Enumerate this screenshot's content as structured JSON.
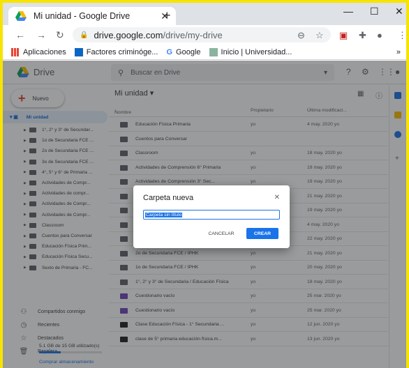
{
  "browser": {
    "tab_title": "Mi unidad - Google Drive",
    "tab_close": "✕",
    "new_tab": "+",
    "min": "—",
    "max": "☐",
    "close": "✕",
    "url_domain": "drive.google.com",
    "url_path": "/drive/my-drive",
    "bookmarks": [
      "Aplicaciones",
      "Factores criminóge...",
      "Google",
      "Inicio | Universidad..."
    ],
    "more": "»"
  },
  "drive": {
    "logo_text": "Drive",
    "search_placeholder": "Buscar en Drive",
    "new_button": "Nuevo",
    "my_drive": "Mi unidad",
    "tree": [
      "1°, 2° y 3° de Secundar...",
      "1o de Secundaria FCE ...",
      "2o de Secundaria FCE ...",
      "3o de Secundaria FCE ...",
      "4°, 5° y 6° de Primaria ...",
      "Actividades de Compr...",
      "Actividades de compr...",
      "Actividades de Compr...",
      "Actividades de Compr...",
      "Classroom",
      "Cuentos para Conversar",
      "Educación Física Prim...",
      "Educación Física Secu...",
      "Sexto de Primaria - FC..."
    ],
    "nav": [
      "Compartidos conmigo",
      "Recientes",
      "Destacados",
      "Papelera"
    ],
    "storage_text": "5.1 GB de 15 GB utilizado(s)",
    "storage_fraction": 0.34,
    "buy_storage": "Comprar almacenamiento",
    "breadcrumb": "Mi unidad",
    "columns": [
      "Nombre",
      "Propietario",
      "Última modificaci..."
    ],
    "rows": [
      {
        "name": "Educación Física Primaria",
        "owner": "yo",
        "modified": "4 may. 2020 yo",
        "type": "folder"
      },
      {
        "name": "Cuentos para Conversar",
        "owner": "",
        "modified": "",
        "type": "shared"
      },
      {
        "name": "Classroom",
        "owner": "yo",
        "modified": "18 may. 2020 yo",
        "type": "folder"
      },
      {
        "name": "Actividades de Comprensión 6° Primaria",
        "owner": "yo",
        "modified": "19 may. 2020 yo",
        "type": "shared"
      },
      {
        "name": "Actividades de Comprensión 3° Sec...",
        "owner": "yo",
        "modified": "19 may. 2020 yo",
        "type": "shared"
      },
      {
        "name": "",
        "owner": "",
        "modified": "21 may. 2020 yo",
        "type": "shared"
      },
      {
        "name": "",
        "owner": "",
        "modified": "19 may. 2020 yo",
        "type": "shared"
      },
      {
        "name": "",
        "owner": "",
        "modified": "4 may. 2020 yo",
        "type": "shared"
      },
      {
        "name": "3o de Secundaria FCE / IPHK",
        "owner": "yo",
        "modified": "22 may. 2020 yo",
        "type": "shared"
      },
      {
        "name": "2o de Secundaria FCE / IPHK",
        "owner": "yo",
        "modified": "21 may. 2020 yo",
        "type": "shared"
      },
      {
        "name": "1o de Secundaria FCE / IPHK",
        "owner": "yo",
        "modified": "20 may. 2020 yo",
        "type": "shared"
      },
      {
        "name": "1°, 2° y 3° de Secundaria / Educación Física",
        "owner": "yo",
        "modified": "18 may. 2020 yo",
        "type": "shared"
      },
      {
        "name": "Cuestionario vacío",
        "owner": "yo",
        "modified": "25 mar. 2020 yo",
        "type": "form"
      },
      {
        "name": "Cuestionario vacío",
        "owner": "yo",
        "modified": "25 mar. 2020 yo",
        "type": "form"
      },
      {
        "name": "Clase Educación Física - 1° Secundaria ...",
        "owner": "yo",
        "modified": "12 jun. 2020 yo",
        "type": "video"
      },
      {
        "name": "clase de 5° primaria educación física.m...",
        "owner": "yo",
        "modified": "13 jun. 2020 yo",
        "type": "video"
      }
    ]
  },
  "dialog": {
    "title": "Carpeta nueva",
    "close": "✕",
    "input_value": "Carpeta sin título",
    "cancel": "CANCELAR",
    "create": "CREAR"
  },
  "colors": {
    "accent": "#1a73e8",
    "frame": "#f6e400"
  }
}
